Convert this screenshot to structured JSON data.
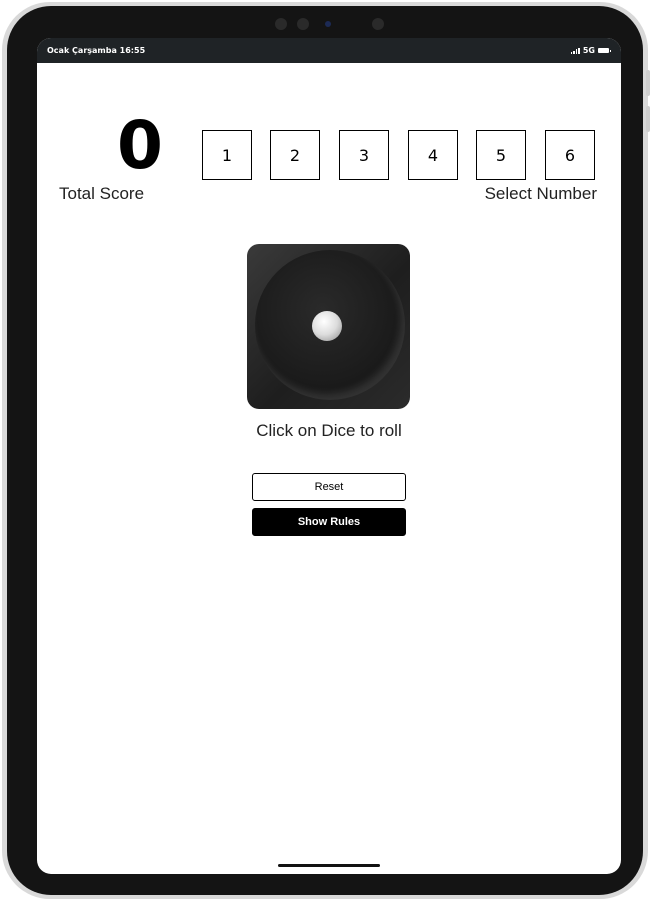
{
  "status_bar": {
    "time_text": "Ocak Çarşamba 16:55",
    "network": "5G",
    "signal_icon": "signal-bars-icon",
    "battery_icon": "battery-icon"
  },
  "game": {
    "total_score": "0",
    "total_score_label": "Total Score",
    "numbers": [
      "1",
      "2",
      "3",
      "4",
      "5",
      "6"
    ],
    "select_label": "Select Number",
    "dice_value": 1,
    "dice_hint": "Click on Dice to roll",
    "reset_label": "Reset",
    "show_rules_label": "Show Rules"
  },
  "colors": {
    "primary_button_bg": "#000000",
    "device_bezel": "#141414",
    "status_bar_bg": "#1f2326"
  }
}
